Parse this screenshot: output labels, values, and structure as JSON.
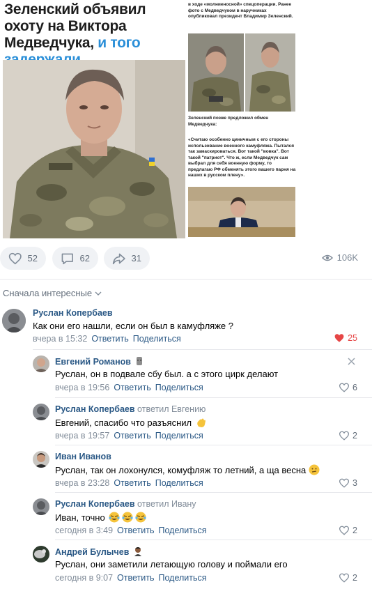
{
  "post": {
    "headline_main": "Зеленский объявил охоту на Виктора Медведчука, ",
    "headline_accent": "и того задержали.",
    "snippet_1": "в ходе «молниеносной» спецоперации. Ранее фото с Медведчуком в наручниках опубликовал президент Владимир Зеленский.",
    "snippet_2": "Зеленский позже предложил обмен Медведчука:",
    "snippet_3": "«Считаю особенно циничным с его стороны использование военного камуфляжа. Пытался так замаскироваться. Вот такой \"вовка\". Вот такой \"патриот\". Что ж, если Медведчук сам выбрал для себя военную форму, то предлагаю РФ обменять этого вашего парня на наших в русском плену»."
  },
  "actions": {
    "likes": "52",
    "comments": "62",
    "shares": "31",
    "views": "106K"
  },
  "sort_label": "Сначала интересные",
  "comments": [
    {
      "author": "Руслан Копербаев",
      "reply_to": "",
      "text": "Как они его нашли, если он был в камуфляже ?",
      "time": "вчера в 15:32",
      "reply_label": "Ответить",
      "share_label": "Поделиться",
      "likes": "25",
      "liked": true
    },
    {
      "author": "Евгений Романов",
      "reply_to": "",
      "text": "Руслан, он в подвале сбу был. а с этого цирк делают",
      "time": "вчера в 19:56",
      "reply_label": "Ответить",
      "share_label": "Поделиться",
      "likes": "6"
    },
    {
      "author": "Руслан Копербаев",
      "reply_to": "ответил Евгению",
      "text": "Евгений, спасибо что разъяснил",
      "time": "вчера в 19:57",
      "reply_label": "Ответить",
      "share_label": "Поделиться",
      "likes": "2"
    },
    {
      "author": "Иван Иванов",
      "reply_to": "",
      "text": "Руслан, так он лохонулся, комуфляж то летний, а ща весна",
      "time": "вчера в 23:28",
      "reply_label": "Ответить",
      "share_label": "Поделиться",
      "likes": "3"
    },
    {
      "author": "Руслан Копербаев",
      "reply_to": "ответил Ивану",
      "text": "Иван, точно",
      "time": "сегодня в 3:49",
      "reply_label": "Ответить",
      "share_label": "Поделиться",
      "likes": "2"
    },
    {
      "author": "Андрей Булычев",
      "reply_to": "",
      "text": "Руслан, они заметили летающую голову и поймали его",
      "time": "сегодня в 9:07",
      "reply_label": "Ответить",
      "share_label": "Поделиться",
      "likes": "2"
    }
  ],
  "colors": {
    "link": "#2a5885",
    "meta": "#818c99",
    "accent_blue": "#2b8fd8",
    "liked_heart": "#e64646",
    "pill_bg": "#f0f2f5"
  }
}
